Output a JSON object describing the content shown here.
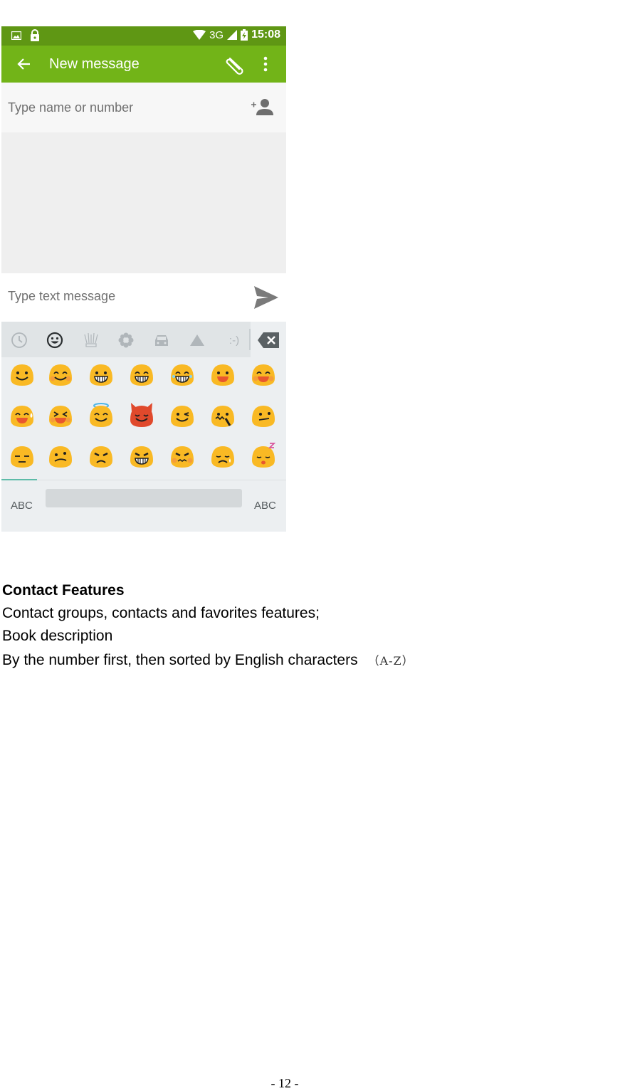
{
  "statusbar": {
    "network": "3G",
    "time": "15:08",
    "icons": [
      "image-notification-icon",
      "lock-icon",
      "wifi-icon",
      "signal-icon",
      "battery-charging-icon"
    ]
  },
  "toolbar": {
    "title": "New message",
    "back_icon": "arrow-left-icon",
    "attach_icon": "paperclip-icon",
    "more_icon": "more-vertical-icon"
  },
  "recipient": {
    "placeholder": "Type name or number",
    "add_contact_icon": "add-person-icon"
  },
  "compose": {
    "placeholder": "Type text message",
    "send_icon": "send-icon"
  },
  "keyboard": {
    "tabs": [
      {
        "name": "recent",
        "icon": "clock-icon",
        "active": false
      },
      {
        "name": "faces",
        "icon": "smiley-icon",
        "active": true
      },
      {
        "name": "objects",
        "icon": "crown-icon",
        "active": false
      },
      {
        "name": "nature",
        "icon": "flower-icon",
        "active": false
      },
      {
        "name": "places",
        "icon": "car-icon",
        "active": false
      },
      {
        "name": "symbols",
        "icon": "triangle-icon",
        "active": false
      },
      {
        "name": "emoticons",
        "label": ":-)",
        "active": false
      }
    ],
    "delete_icon": "backspace-icon",
    "emoji_rows": [
      [
        "smile",
        "blush",
        "grin",
        "grinning",
        "joy",
        "open-mouth-smile",
        "happy-blush"
      ],
      [
        "sweat-smile",
        "laughing",
        "innocent",
        "imp",
        "wink",
        "zipper-mouth",
        "neutral-look"
      ],
      [
        "expressionless",
        "confused",
        "angry",
        "grimacing-angry",
        "pouting",
        "sad-tear",
        "sleeping"
      ]
    ],
    "bottom": {
      "left_label": "ABC",
      "right_label": "ABC"
    },
    "accent": "#5dbba8"
  },
  "colors": {
    "statusbar": "#5f9714",
    "toolbar": "#72b418",
    "emoji_yellow": "#f9b924",
    "emoji_red": "#e0492c"
  },
  "document": {
    "heading": "Contact Features",
    "lines": [
      "Contact groups, contacts and favorites features;",
      "Book description",
      "By the number first, then sorted by English characters"
    ],
    "range_note": "（A-Z）",
    "page_number": "- 12 -"
  }
}
